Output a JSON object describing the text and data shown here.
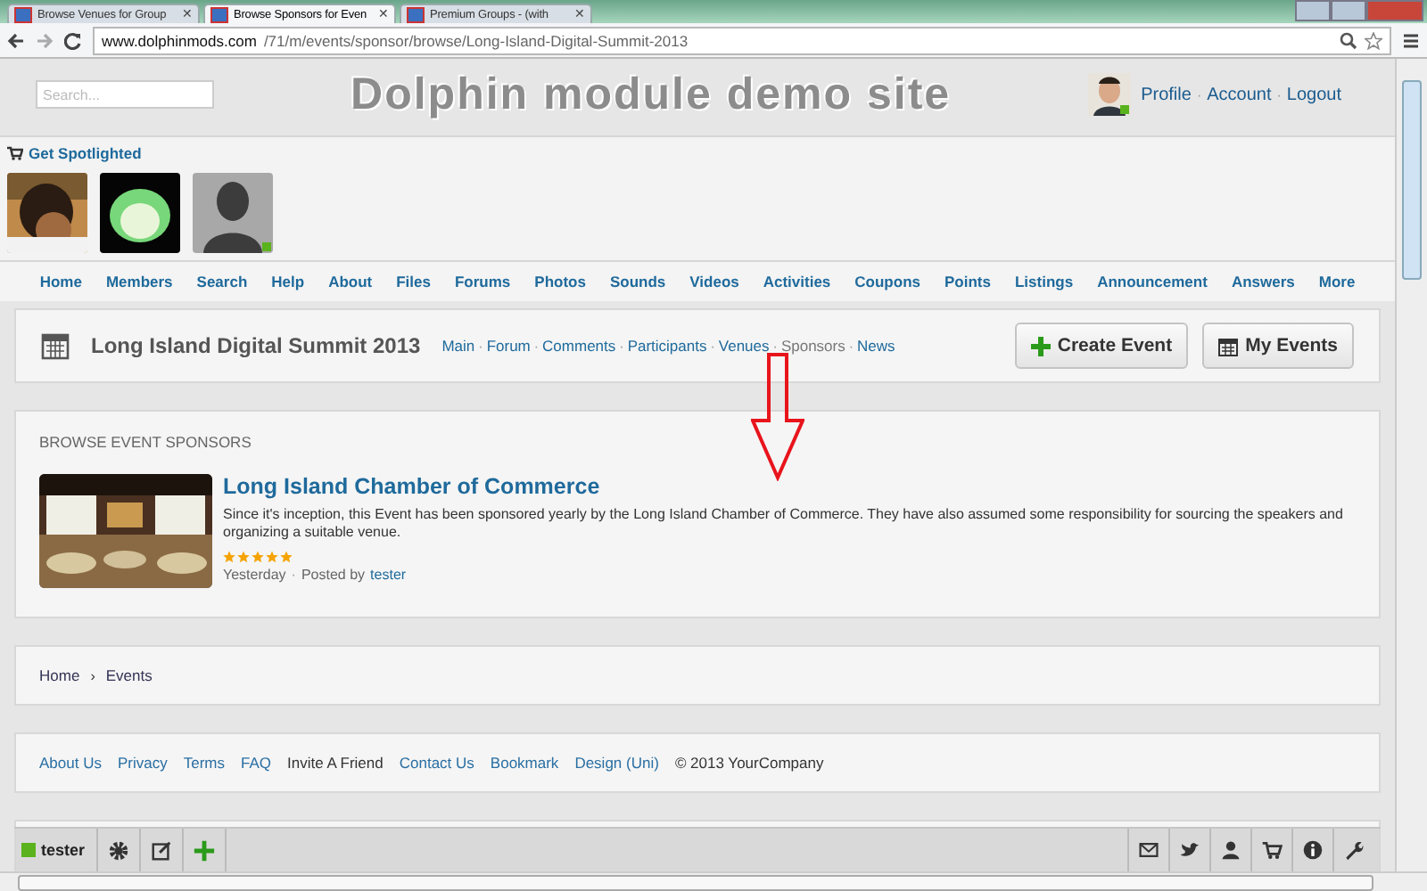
{
  "browser": {
    "tabs": [
      {
        "title": "Browse Venues for Group",
        "selected": false
      },
      {
        "title": "Browse Sponsors for Even",
        "selected": true
      },
      {
        "title": "Premium Groups - (with",
        "selected": false
      }
    ],
    "close_glyph": "✕",
    "url": {
      "domain": "www.dolphinmods.com",
      "path": "/71/m/events/sponsor/browse/Long-Island-Digital-Summit-2013"
    }
  },
  "header": {
    "search": {
      "placeholder": "Search..."
    },
    "site_title": "Dolphin module demo site",
    "user_links": [
      "Profile",
      "Account",
      "Logout"
    ],
    "separator": "·"
  },
  "spotlight": {
    "title": "Get Spotlighted",
    "members": [
      {
        "kind": "picture",
        "online": false
      },
      {
        "kind": "cartoon",
        "online": false
      },
      {
        "kind": "silhouette",
        "online": true
      }
    ]
  },
  "nav": [
    "Home",
    "Members",
    "Search",
    "Help",
    "About",
    "Files",
    "Forums",
    "Photos",
    "Sounds",
    "Videos",
    "Activities",
    "Coupons",
    "Points",
    "Listings",
    "Announcement",
    "Answers",
    "More"
  ],
  "event": {
    "title": "Long Island Digital Summit 2013",
    "separator": "·",
    "links": [
      {
        "label": "Main",
        "selected": false
      },
      {
        "label": "Forum",
        "selected": false
      },
      {
        "label": "Comments",
        "selected": false
      },
      {
        "label": "Participants",
        "selected": false
      },
      {
        "label": "Venues",
        "selected": false
      },
      {
        "label": "Sponsors",
        "selected": true
      },
      {
        "label": "News",
        "selected": false
      }
    ],
    "buttons": [
      {
        "label": "Create Event",
        "kind": "create"
      },
      {
        "label": "My Events",
        "kind": "calendar"
      }
    ]
  },
  "sponsors": {
    "heading": "BROWSE EVENT SPONSORS",
    "items": [
      {
        "title": "Long Island Chamber of Commerce",
        "description": "Since it's inception, this Event has been sponsored yearly by the Long Island Chamber of Commerce. They have also assumed some responsibility for sourcing the speakers and organizing a suitable venue.",
        "stars": 5,
        "date": "Yesterday",
        "separator": "·",
        "posted_label": "Posted by",
        "author": "tester"
      }
    ]
  },
  "breadcrumb": {
    "items": [
      "Home",
      "Events"
    ],
    "separator": "›"
  },
  "footer": {
    "links": [
      {
        "label": "About Us",
        "kind": "link"
      },
      {
        "label": "Privacy",
        "kind": "link"
      },
      {
        "label": "Terms",
        "kind": "link"
      },
      {
        "label": "FAQ",
        "kind": "link"
      },
      {
        "label": "Invite A Friend",
        "kind": "plain"
      },
      {
        "label": "Contact Us",
        "kind": "link"
      },
      {
        "label": "Bookmark",
        "kind": "link"
      },
      {
        "label": "Design (Uni)",
        "kind": "link"
      }
    ],
    "copyright": "© 2013 YourCompany"
  },
  "toolbar": {
    "user": "tester",
    "online": true
  }
}
